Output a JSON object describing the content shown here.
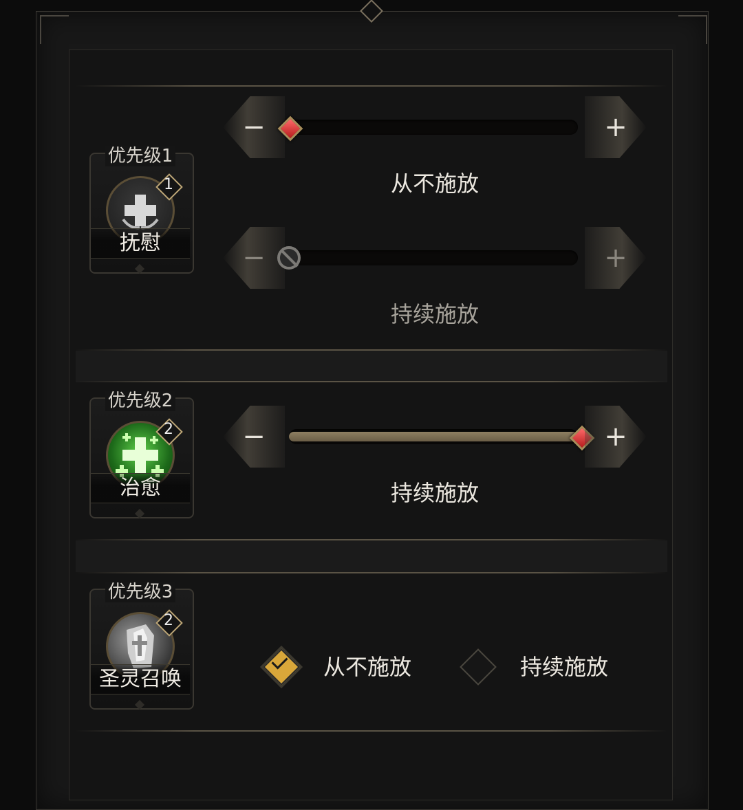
{
  "sections": [
    {
      "priority_label": "优先级1",
      "skill_name": "抚慰",
      "level": "1",
      "icon": "soothe-cross-icon",
      "sliders": [
        {
          "value_label": "从不施放",
          "thumb": "red-gem-thumb",
          "fill": 0,
          "enabled": true
        },
        {
          "value_label": "持续施放",
          "thumb": "disabled-circle-thumb",
          "fill": 0,
          "enabled": false
        }
      ]
    },
    {
      "priority_label": "优先级2",
      "skill_name": "治愈",
      "level": "2",
      "icon": "heal-green-cross-icon",
      "sliders": [
        {
          "value_label": "持续施放",
          "thumb": "red-gem-thumb",
          "fill": 1,
          "enabled": true
        }
      ]
    },
    {
      "priority_label": "优先级3",
      "skill_name": "圣灵召唤",
      "level": "2",
      "icon": "holy-spirit-summon-icon",
      "options": [
        {
          "label": "从不施放",
          "checked": true
        },
        {
          "label": "持续施放",
          "checked": false
        }
      ]
    }
  ],
  "buttons": {
    "minus": "−",
    "plus": "+"
  },
  "colors": {
    "accent_gold": "#d9a73a",
    "gem_red": "#c42a2a",
    "fill": "#7d6f55"
  }
}
